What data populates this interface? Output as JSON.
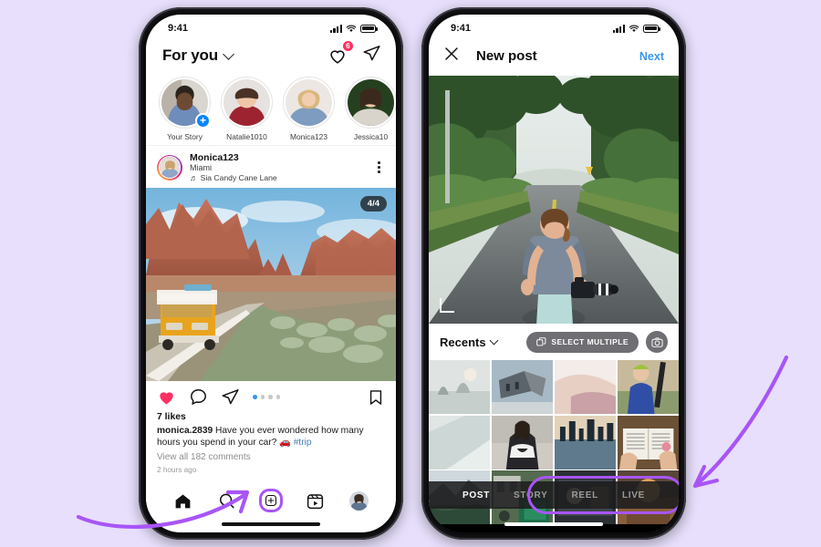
{
  "background_color": "#e7dffb",
  "accent_highlight": "#a855f7",
  "left_phone": {
    "status": {
      "time": "9:41",
      "signal_icon": "cellular-bars-icon",
      "wifi_icon": "wifi-icon",
      "battery_icon": "battery-full-icon"
    },
    "header": {
      "title": "For you",
      "chevron_icon": "chevron-down-icon",
      "heart_icon": "heart-icon",
      "notifications_badge": "6",
      "share_icon": "paper-plane-icon"
    },
    "stories": [
      {
        "name": "Your Story",
        "has_add": true
      },
      {
        "name": "Natalie1010",
        "has_add": false
      },
      {
        "name": "Monica123",
        "has_add": false
      },
      {
        "name": "Jessica10",
        "has_add": false
      }
    ],
    "post": {
      "username": "Monica123",
      "location": "Miami",
      "music_icon": "music-note-icon",
      "music": "Sia Candy Cane Lane",
      "more_icon": "more-options-icon",
      "carousel_counter": "4/4",
      "like_icon": "heart-filled-icon",
      "comment_icon": "comment-icon",
      "share_icon": "paper-plane-icon",
      "save_icon": "bookmark-icon",
      "pager_dots": 4,
      "pager_active": 0,
      "likes": "7 likes",
      "caption_user": "monica.2839",
      "caption_text": "Have you ever wondered how many hours you spend in your car?",
      "caption_emoji": "🚗",
      "caption_hashtag": "#trip",
      "view_comments": "View all 182 comments",
      "timestamp": "2 hours ago"
    },
    "tabbar": [
      {
        "name": "home-icon",
        "label": "Home"
      },
      {
        "name": "search-icon",
        "label": "Search"
      },
      {
        "name": "create-icon",
        "label": "Create",
        "highlighted": true
      },
      {
        "name": "reels-icon",
        "label": "Reels"
      },
      {
        "name": "profile-avatar",
        "label": "Profile"
      }
    ]
  },
  "right_phone": {
    "status": {
      "time": "9:41",
      "signal_icon": "cellular-bars-icon",
      "wifi_icon": "wifi-icon",
      "battery_icon": "battery-full-icon"
    },
    "header": {
      "close_icon": "close-x-icon",
      "title": "New post",
      "next_label": "Next"
    },
    "preview": {
      "expand_icon": "expand-crop-icon"
    },
    "gallery_bar": {
      "album": "Recents",
      "chevron_icon": "chevron-down-icon",
      "select_multiple_label": "SELECT MULTIPLE",
      "select_multiple_icon": "copy-layers-icon",
      "camera_icon": "camera-icon"
    },
    "modes": [
      {
        "label": "POST",
        "active": true
      },
      {
        "label": "STORY",
        "active": false
      },
      {
        "label": "REEL",
        "active": false
      },
      {
        "label": "LIVE",
        "active": false
      }
    ],
    "modes_highlighted": true
  },
  "annotations": [
    {
      "name": "arrow-to-create-button",
      "color": "#a855f7"
    },
    {
      "name": "arrow-to-mode-tabs",
      "color": "#a855f7"
    }
  ]
}
